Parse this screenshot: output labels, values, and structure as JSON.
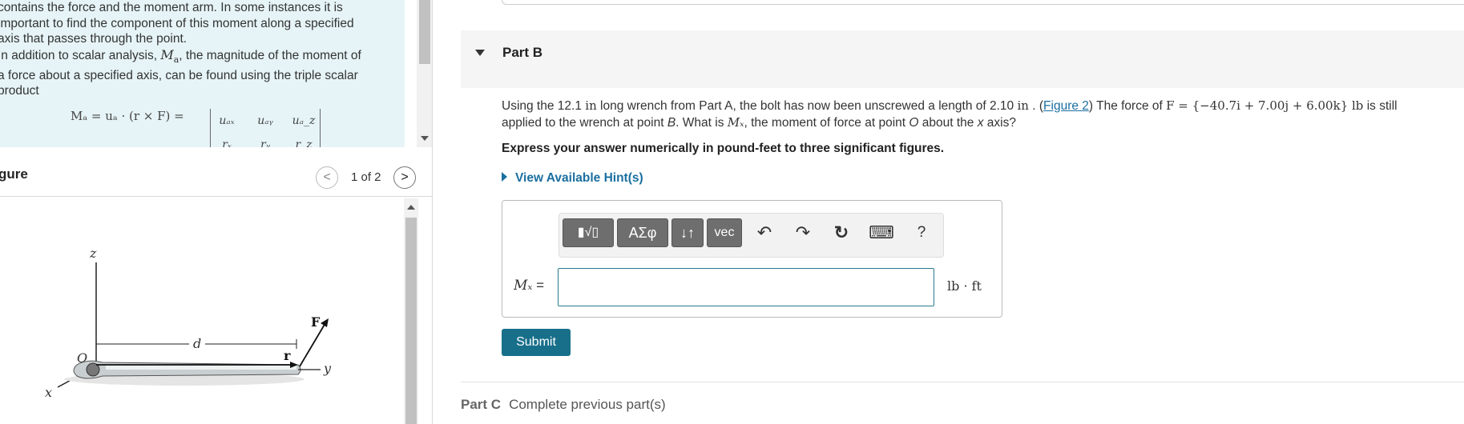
{
  "intro": {
    "lines": [
      "contains the force and the moment arm. In some instances it is",
      "important to find the component of this moment along a specified",
      "axis that passes through the point."
    ],
    "para2_pre": "In addition to scalar analysis, ",
    "para2_var": "M",
    "para2_sub": "a",
    "para2_post": ", the magnitude of the moment of",
    "para2_line2": "a force about a specified axis, can be found using the triple scalar",
    "para2_line3": "product",
    "formula": "Mₐ = uₐ · (r × F) =",
    "matrix_row1": [
      "uₐₓ",
      "uₐᵧ",
      "uₐ_z"
    ],
    "matrix_row2": [
      "rₓ",
      "rᵧ",
      "r_z"
    ]
  },
  "figure_panel": {
    "title": "gure",
    "prev_label": "<",
    "next_label": ">",
    "page_count": "1 of 2",
    "labels": {
      "z": "z",
      "x": "x",
      "y": "y",
      "O": "O",
      "d": "d",
      "r": "r",
      "F": "F"
    }
  },
  "part_b": {
    "label": "Part B",
    "question": {
      "t1": "Using the 12.1 ",
      "u1": "in",
      "t2": " long wrench from Part A, the bolt has now been unscrewed a length of 2.10 ",
      "u2": "in",
      "t3": " . (",
      "link": "Figure 2",
      "t4": ") The force of ",
      "force": "F = {−40.7i + 7.00j + 6.00k} lb",
      "t5": " is still",
      "line2_pre": "applied to the wrench at point ",
      "pointB": "B",
      "line2_mid": ". What is ",
      "mx": "Mₓ",
      "line2_mid2": ", the moment of force at point ",
      "pointO": "O",
      "line2_mid3": " about the ",
      "axis": "x",
      "line2_post": " axis?"
    },
    "instruction": "Express your answer numerically in pound-feet to three significant figures.",
    "hint_label": "View Available Hint(s)",
    "toolbar": {
      "templates": "▮√▯",
      "greek": "ΑΣφ",
      "arrows": "↓↑",
      "vec": "vec",
      "undo": "↶",
      "redo": "↷",
      "reset": "↻",
      "keyboard": "⌨",
      "help": "?"
    },
    "answer_label_var": "Mₓ",
    "answer_label_eq": " =",
    "answer_value": "",
    "units": "lb · ft",
    "submit_label": "Submit"
  },
  "part_c": {
    "label": "Part C",
    "status": "Complete previous part(s)"
  }
}
